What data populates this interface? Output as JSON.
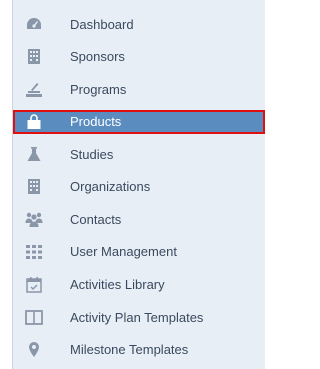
{
  "sidebar": {
    "items": [
      {
        "label": "Dashboard",
        "icon": "dashboard-icon",
        "active": false
      },
      {
        "label": "Sponsors",
        "icon": "building-icon",
        "active": false
      },
      {
        "label": "Programs",
        "icon": "programs-icon",
        "active": false
      },
      {
        "label": "Products",
        "icon": "bag-icon",
        "active": true
      },
      {
        "label": "Studies",
        "icon": "flask-icon",
        "active": false
      },
      {
        "label": "Organizations",
        "icon": "building-icon",
        "active": false
      },
      {
        "label": "Contacts",
        "icon": "users-icon",
        "active": false
      },
      {
        "label": "User Management",
        "icon": "grid-icon",
        "active": false
      },
      {
        "label": "Activities Library",
        "icon": "calendar-icon",
        "active": false
      },
      {
        "label": "Activity Plan Templates",
        "icon": "book-icon",
        "active": false
      },
      {
        "label": "Milestone Templates",
        "icon": "map-pin-icon",
        "active": false
      }
    ],
    "colors": {
      "background": "#e8eef6",
      "active_background": "#5b8cbf",
      "active_outline": "#e01010",
      "text": "#3a4a5e",
      "icon": "#8a97a8"
    }
  }
}
